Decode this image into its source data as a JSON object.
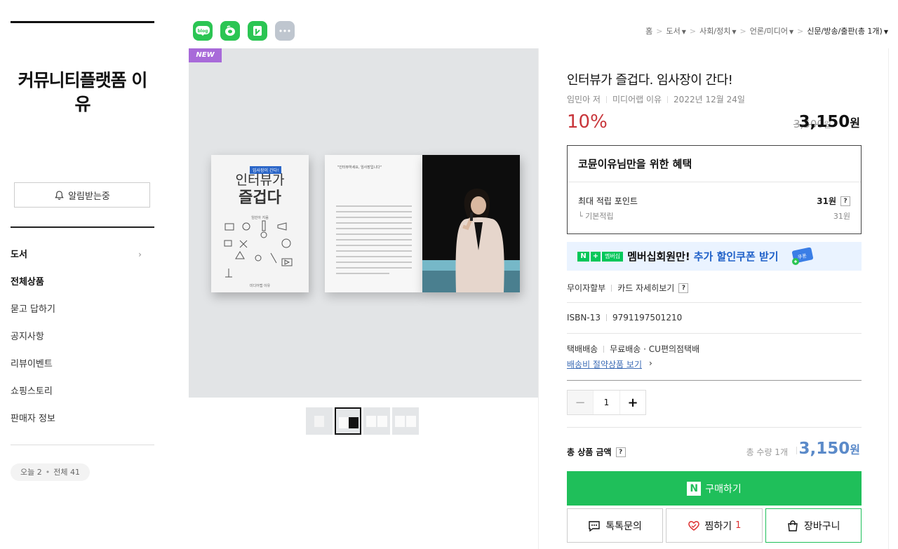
{
  "sidebar": {
    "store_name": "커뮤니티플랫폼 이유",
    "alarm_label": "알림받는중",
    "menu": [
      {
        "label": "도서"
      },
      {
        "label": "전체상품"
      },
      {
        "label": "묻고 답하기"
      },
      {
        "label": "공지사항"
      },
      {
        "label": "리뷰이벤트"
      },
      {
        "label": "쇼핑스토리"
      },
      {
        "label": "판매자 정보"
      }
    ],
    "visit_today": "오늘 2",
    "visit_total": "전체 41"
  },
  "share": {
    "blog_label": "blog",
    "icons": [
      "blog-icon",
      "cafe-icon",
      "keep-icon",
      "more-icon"
    ]
  },
  "breadcrumb": {
    "items": [
      "홈",
      "도서",
      "사회/정치",
      "언론/미디어",
      "신문/방송/출판(총 1개)"
    ]
  },
  "gallery": {
    "badge": "NEW",
    "cover_tag": "임사장이 간다!",
    "cover_title_line1": "인터뷰가",
    "cover_title_line2": "즐겁다",
    "cover_author": "임민아 지음",
    "cover_publisher": "미디어랩 이유",
    "page_heading": "\"인터뷰하세요, 임사장입니다\"",
    "thumb_count": 4,
    "selected_thumb": 2
  },
  "product": {
    "title": "인터뷰가 즐겁다. 임사장이 간다!",
    "author": "임민아 저",
    "publisher": "미디어랩 이유",
    "date": "2022년 12월 24일",
    "discount": "10%",
    "original_price": "3,500",
    "original_unit": "원",
    "price": "3,150",
    "price_unit": "원"
  },
  "benefit": {
    "title": "코뮨이유님만을 위한 혜택",
    "max_points_label": "최대 적립 포인트",
    "max_points_value": "31원",
    "base_points_label": "└ 기본적립",
    "base_points_value": "31원",
    "help": "?"
  },
  "member_banner": {
    "n": "N",
    "plus": "+",
    "pill": "멤버십",
    "text_black": "멤버십회원만!",
    "text_blue": "추가 할인쿠폰 받기",
    "coupon_label": "쿠폰"
  },
  "installment": {
    "label1": "무이자할부",
    "label2": "카드 자세히보기"
  },
  "isbn": {
    "label": "ISBN-13",
    "value": "9791197501210"
  },
  "shipping": {
    "label": "택배배송",
    "value": "무료배송 · CU편의점택배",
    "link": "배송비 절약상품 보기"
  },
  "quantity": {
    "minus": "−",
    "value": "1",
    "plus": "+"
  },
  "total": {
    "label": "총 상품 금액",
    "qty_text": "총 수량 1개",
    "price": "3,150",
    "unit": "원"
  },
  "actions": {
    "buy_logo": "N",
    "buy_label": "구매하기",
    "talk_label": "톡톡문의",
    "wish_label": "찜하기",
    "wish_count": "1",
    "cart_label": "장바구니"
  },
  "colors": {
    "accent_green": "#1fbf5a",
    "discount_red": "#c8353a",
    "total_blue": "#5b8ac9",
    "badge_purple": "#a86ad9"
  }
}
